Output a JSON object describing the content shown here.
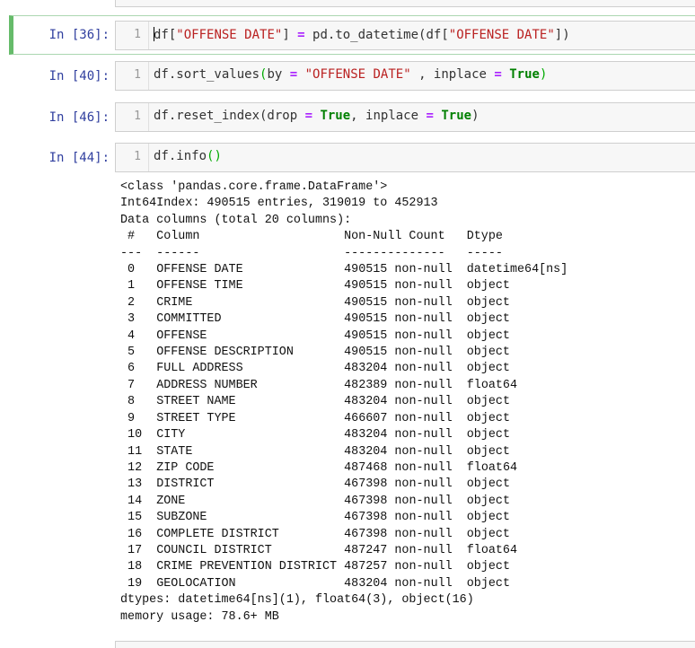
{
  "cells": [
    {
      "prompt": "In [36]:",
      "line": "1",
      "code": {
        "a": "df[",
        "b": "\"OFFENSE DATE\"",
        "c": "] ",
        "d": "=",
        "e": " pd.to_datetime(df[",
        "f": "\"OFFENSE DATE\"",
        "g": "])"
      }
    },
    {
      "prompt": "In [40]:",
      "line": "1",
      "code": {
        "a": "df.sort_values",
        "b": "(",
        "c": "by ",
        "d": "=",
        "e": " ",
        "f": "\"OFFENSE DATE\"",
        "g": " , inplace ",
        "h": "=",
        "i": " ",
        "j": "True",
        "k": ")"
      }
    },
    {
      "prompt": "In [46]:",
      "line": "1",
      "code": {
        "a": "df.reset_index(drop ",
        "b": "=",
        "c": " ",
        "d": "True",
        "e": ", inplace ",
        "f": "=",
        "g": " ",
        "h": "True",
        "i": ")"
      }
    },
    {
      "prompt": "In [44]:",
      "line": "1",
      "code": {
        "a": "df.info",
        "b": "()"
      }
    }
  ],
  "output": {
    "header": [
      "<class 'pandas.core.frame.DataFrame'>",
      "Int64Index: 490515 entries, 319019 to 452913",
      "Data columns (total 20 columns):"
    ],
    "col_header": " #   Column                    Non-Null Count   Dtype         ",
    "col_rule": "---  ------                    --------------   -----         ",
    "rows": [
      {
        "idx": "0",
        "name": "OFFENSE DATE",
        "count": "490515 non-null",
        "dtype": "datetime64[ns]"
      },
      {
        "idx": "1",
        "name": "OFFENSE TIME",
        "count": "490515 non-null",
        "dtype": "object"
      },
      {
        "idx": "2",
        "name": "CRIME",
        "count": "490515 non-null",
        "dtype": "object"
      },
      {
        "idx": "3",
        "name": "COMMITTED",
        "count": "490515 non-null",
        "dtype": "object"
      },
      {
        "idx": "4",
        "name": "OFFENSE",
        "count": "490515 non-null",
        "dtype": "object"
      },
      {
        "idx": "5",
        "name": "OFFENSE DESCRIPTION",
        "count": "490515 non-null",
        "dtype": "object"
      },
      {
        "idx": "6",
        "name": "FULL ADDRESS",
        "count": "483204 non-null",
        "dtype": "object"
      },
      {
        "idx": "7",
        "name": "ADDRESS NUMBER",
        "count": "482389 non-null",
        "dtype": "float64"
      },
      {
        "idx": "8",
        "name": "STREET NAME",
        "count": "483204 non-null",
        "dtype": "object"
      },
      {
        "idx": "9",
        "name": "STREET TYPE",
        "count": "466607 non-null",
        "dtype": "object"
      },
      {
        "idx": "10",
        "name": "CITY",
        "count": "483204 non-null",
        "dtype": "object"
      },
      {
        "idx": "11",
        "name": "STATE",
        "count": "483204 non-null",
        "dtype": "object"
      },
      {
        "idx": "12",
        "name": "ZIP CODE",
        "count": "487468 non-null",
        "dtype": "float64"
      },
      {
        "idx": "13",
        "name": "DISTRICT",
        "count": "467398 non-null",
        "dtype": "object"
      },
      {
        "idx": "14",
        "name": "ZONE",
        "count": "467398 non-null",
        "dtype": "object"
      },
      {
        "idx": "15",
        "name": "SUBZONE",
        "count": "467398 non-null",
        "dtype": "object"
      },
      {
        "idx": "16",
        "name": "COMPLETE DISTRICT",
        "count": "467398 non-null",
        "dtype": "object"
      },
      {
        "idx": "17",
        "name": "COUNCIL DISTRICT",
        "count": "487247 non-null",
        "dtype": "float64"
      },
      {
        "idx": "18",
        "name": "CRIME PREVENTION DISTRICT",
        "count": "487257 non-null",
        "dtype": "object"
      },
      {
        "idx": "19",
        "name": "GEOLOCATION",
        "count": "483204 non-null",
        "dtype": "object"
      }
    ],
    "footer": [
      "dtypes: datetime64[ns](1), float64(3), object(16)",
      "memory usage: 78.6+ MB"
    ]
  }
}
